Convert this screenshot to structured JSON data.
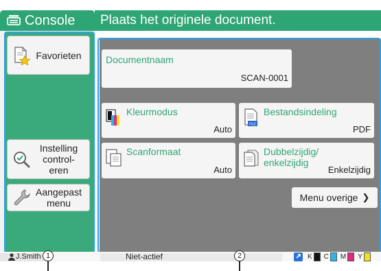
{
  "header": {
    "app_title": "Console",
    "message": "Plaats het originele document."
  },
  "sidebar": {
    "favorites": "Favorieten",
    "check_settings": [
      "Instelling",
      "control-",
      "eren"
    ],
    "custom_menu": [
      "Aangepast",
      "menu"
    ]
  },
  "main": {
    "document_name": {
      "label": "Documentnaam",
      "value": "SCAN-0001"
    },
    "color_mode": {
      "label": "Kleurmodus",
      "value": "Auto"
    },
    "file_format": {
      "label": "Bestandsindeling",
      "value": "PDF"
    },
    "scan_size": {
      "label": "Scanformaat",
      "value": "Auto"
    },
    "duplex": {
      "label": [
        "Dubbelzijdig/",
        "enkelzijdig"
      ],
      "value": "Enkelzijdig"
    },
    "more_menu": "Menu overige",
    "more_chevron": "❯"
  },
  "status": {
    "user": "J.Smith",
    "state": "Niet-actief",
    "ink": [
      {
        "label": "K",
        "color": "#111111"
      },
      {
        "label": "C",
        "color": "#29b6e8"
      },
      {
        "label": "M",
        "color": "#e0287d"
      },
      {
        "label": "Y",
        "color": "#f3e11a"
      }
    ],
    "file_icon_text": "FILE"
  },
  "callouts": [
    "1",
    "2"
  ],
  "colors": {
    "accent": "#2ea574",
    "highlight": "#2f9fe8",
    "panel_gray": "#7f7f7f"
  }
}
